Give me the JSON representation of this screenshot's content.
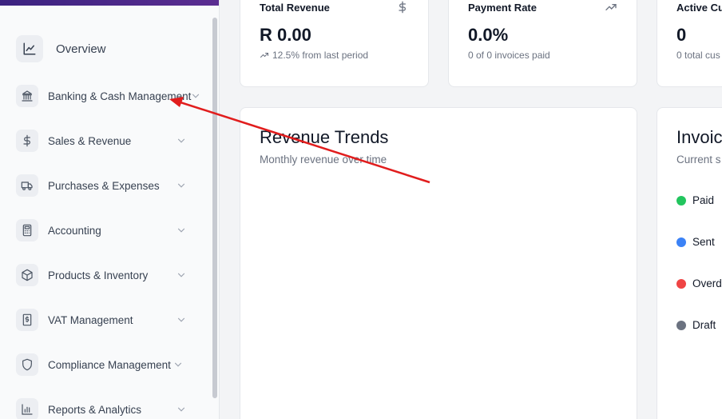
{
  "sidebar": {
    "overview": {
      "label": "Overview",
      "icon": "line-chart-icon"
    },
    "items": [
      {
        "label": "Banking & Cash Management",
        "icon": "bank-icon"
      },
      {
        "label": "Sales & Revenue",
        "icon": "dollar-icon"
      },
      {
        "label": "Purchases & Expenses",
        "icon": "truck-icon"
      },
      {
        "label": "Accounting",
        "icon": "calculator-icon"
      },
      {
        "label": "Products & Inventory",
        "icon": "package-icon"
      },
      {
        "label": "VAT Management",
        "icon": "receipt-icon"
      },
      {
        "label": "Compliance Management",
        "icon": "shield-icon"
      },
      {
        "label": "Reports & Analytics",
        "icon": "bar-chart-icon"
      }
    ]
  },
  "stats": [
    {
      "title": "Total Revenue",
      "value": "R 0.00",
      "sub": "12.5% from last period",
      "icon": "dollar-icon"
    },
    {
      "title": "Payment Rate",
      "value": "0.0%",
      "sub": "0 of 0 invoices paid",
      "icon": "trending-up-icon"
    },
    {
      "title": "Active Cu",
      "value": "0",
      "sub": "0 total cus"
    }
  ],
  "revenue_panel": {
    "title": "Revenue Trends",
    "subtitle": "Monthly revenue over time"
  },
  "invoice_panel": {
    "title": "Invoic",
    "subtitle": "Current s",
    "legend": [
      {
        "label": "Paid",
        "color": "#22c55e"
      },
      {
        "label": "Sent",
        "color": "#3b82f6"
      },
      {
        "label": "Overd",
        "color": "#ef4444"
      },
      {
        "label": "Draft",
        "color": "#6b7280"
      }
    ]
  },
  "colors": {
    "annotation_arrow": "#e11d1d",
    "brand_gradient_start": "#3b2280",
    "brand_gradient_end": "#5b2d91"
  }
}
